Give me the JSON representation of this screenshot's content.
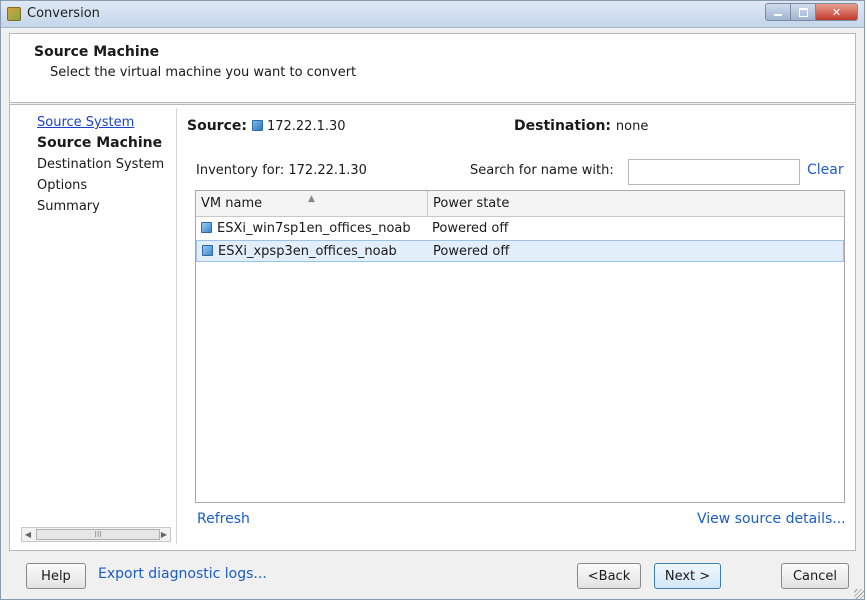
{
  "window": {
    "title": "Conversion",
    "controls": [
      "minimize",
      "maximize",
      "close"
    ]
  },
  "header": {
    "title": "Source Machine",
    "subtitle": "Select the virtual machine you want to convert"
  },
  "nav": {
    "items": [
      {
        "label": "Source System",
        "state": "link"
      },
      {
        "label": "Source Machine",
        "state": "current"
      },
      {
        "label": "Destination System",
        "state": "normal"
      },
      {
        "label": "Options",
        "state": "normal"
      },
      {
        "label": "Summary",
        "state": "normal"
      }
    ],
    "scroll_thumb_glyph": "III"
  },
  "source": {
    "label": "Source:",
    "value": "172.22.1.30",
    "icon": "server-icon"
  },
  "destination": {
    "label": "Destination:",
    "value": "none"
  },
  "inventory": {
    "label": "Inventory for: 172.22.1.30"
  },
  "search": {
    "label": "Search for name with:",
    "value": "",
    "clear_label": "Clear"
  },
  "vm_table": {
    "columns": [
      "VM name",
      "Power state"
    ],
    "sorted_column": "VM name",
    "rows": [
      {
        "name": "ESXi_win7sp1en_offices_noab",
        "power_state": "Powered off",
        "selected": false,
        "icon": "vm-icon"
      },
      {
        "name": "ESXi_xpsp3en_offices_noab",
        "power_state": "Powered off",
        "selected": true,
        "icon": "vm-icon"
      }
    ]
  },
  "links": {
    "refresh": "Refresh",
    "view_source_details": "View source details..."
  },
  "footer": {
    "help": "Help",
    "export_logs": "Export diagnostic logs...",
    "back": "<Back",
    "next": "Next >",
    "cancel": "Cancel"
  },
  "colors": {
    "link": "#1a5cc8",
    "selection": "#e3eefb",
    "titlebar": "#c5d6ea"
  }
}
